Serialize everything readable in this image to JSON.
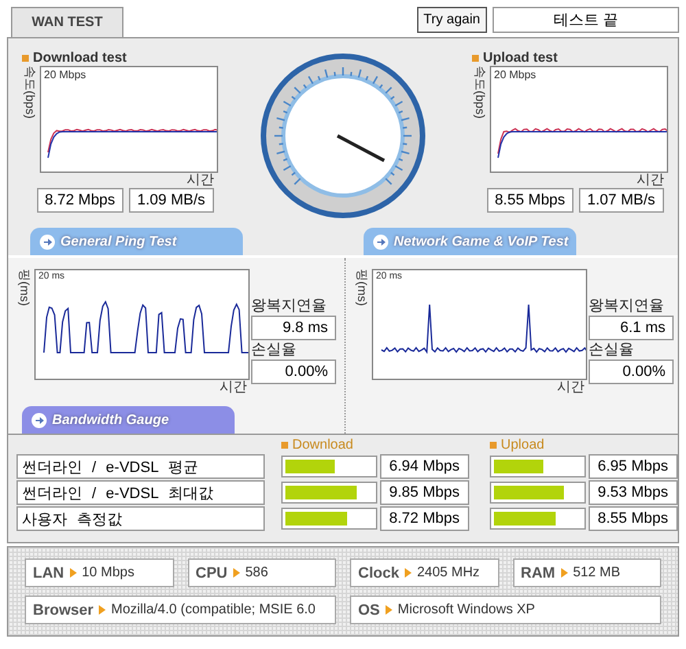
{
  "tab": {
    "label": "WAN TEST",
    "selected": true
  },
  "try_again": "Try again",
  "status": "테스트 끝",
  "speed": [
    {
      "title": "Download test",
      "y_label": "속도(bps)",
      "scale": "20 Mbps",
      "x_label": "시간",
      "rate": "8.72 Mbps",
      "bytes": "1.09 MB/s"
    },
    {
      "title": "Upload test",
      "y_label": "속도(bps)",
      "scale": "20 Mbps",
      "x_label": "시간",
      "rate": "8.55 Mbps",
      "bytes": "1.07 MB/s"
    }
  ],
  "ping": [
    {
      "title": "General Ping Test",
      "kind": "jagged",
      "y_label": "핑(ms)",
      "scale": "20 ms",
      "x_label": "시간",
      "latency_label": "왕복지연율",
      "latency": "9.8 ms",
      "loss_label": "손실율",
      "loss": "0.00%"
    },
    {
      "title": "Network Game & VoIP Test",
      "kind": "spiky",
      "y_label": "핑(ms)",
      "scale": "20 ms",
      "x_label": "시간",
      "latency_label": "왕복지연율",
      "latency": "6.1 ms",
      "loss_label": "손실율",
      "loss": "0.00%"
    }
  ],
  "bandwidth": {
    "title": "Bandwidth Gauge",
    "download_label": "Download",
    "upload_label": "Upload",
    "rows": [
      {
        "name": "썬더라인 / e-VDSL 평균",
        "download": {
          "level": 0.57,
          "reading": "6.94 Mbps"
        },
        "upload": {
          "level": 0.57,
          "reading": "6.95 Mbps"
        }
      },
      {
        "name": "썬더라인 / e-VDSL 최대값",
        "download": {
          "level": 0.81,
          "reading": "9.85 Mbps"
        },
        "upload": {
          "level": 0.79,
          "reading": "9.53 Mbps"
        }
      },
      {
        "name": "사용자 측정값",
        "download": {
          "level": 0.71,
          "reading": "8.72 Mbps"
        },
        "upload": {
          "level": 0.7,
          "reading": "8.55 Mbps"
        }
      }
    ]
  },
  "system": [
    {
      "label": "LAN",
      "value": "10 Mbps"
    },
    {
      "label": "CPU",
      "value": "586"
    },
    {
      "label": "Clock",
      "value": "2405 MHz"
    },
    {
      "label": "RAM",
      "value": "512 MB"
    },
    {
      "label": "Browser",
      "value": "Mozilla/4.0 (compatible; MSIE 6.0"
    },
    {
      "label": "OS",
      "value": "Microsoft Windows XP"
    }
  ]
}
